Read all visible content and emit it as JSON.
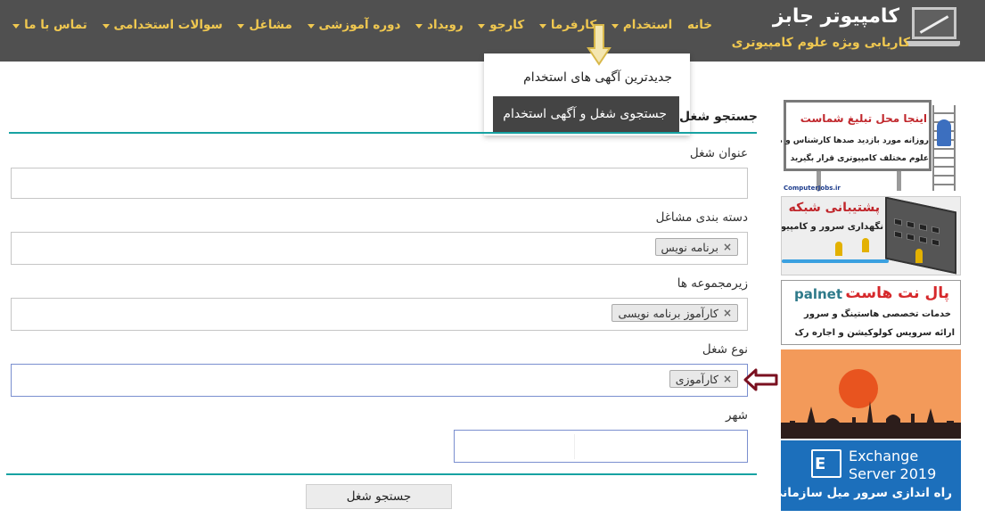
{
  "header": {
    "logo_title": "کامپیوتر جابز",
    "logo_subtitle": "کاریابی ویژه علوم کامپیوتری",
    "nav": [
      {
        "label": "خانه",
        "has_dropdown": false
      },
      {
        "label": "استخدام",
        "has_dropdown": true
      },
      {
        "label": "کارفرما",
        "has_dropdown": true
      },
      {
        "label": "کارجو",
        "has_dropdown": true
      },
      {
        "label": "رویداد",
        "has_dropdown": true
      },
      {
        "label": "دوره آموزشی",
        "has_dropdown": true
      },
      {
        "label": "مشاغل",
        "has_dropdown": true
      },
      {
        "label": "سوالات استخدامی",
        "has_dropdown": true
      },
      {
        "label": "تماس با ما",
        "has_dropdown": true
      }
    ],
    "accent_color": "#f0c850",
    "bar_color": "#505050"
  },
  "dropdown": {
    "items": [
      {
        "label": "جدیدترین آگهی های استخدام"
      },
      {
        "label": "جستجوی شغل و آگهی استخدام"
      }
    ]
  },
  "search_form": {
    "section_title": "جستجو شغل",
    "job_title_label": "عنوان شغل",
    "job_title_value": "",
    "category_label": "دسته بندی مشاغل",
    "category_tokens": [
      "برنامه نویس"
    ],
    "subcategory_label": "زیرمجموعه ها",
    "subcategory_tokens": [
      "کارآموز برنامه نویسی"
    ],
    "job_type_label": "نوع شغل",
    "job_type_tokens": [
      "کارآموزی"
    ],
    "city_label": "شهر",
    "city_value": "",
    "submit_label": "جستجو شغل",
    "remove_symbol": "×"
  },
  "ads": {
    "billboard": {
      "title": "اینجا محل تبلیغ شماست",
      "line1": "روزانه مورد بازدید صدها کارشناس و مدیر",
      "line2": "علوم مختلف کامپیوتری قرار بگیرید",
      "footer": "ComputerJobs.ir"
    },
    "network": {
      "title": "پشتیبانی شبکه",
      "subtitle": "نگهداری سرور و کامپیوتر"
    },
    "hosting": {
      "brand": "پال نت هاست",
      "logo": "palnet",
      "line1": "خدمات تخصصی هاستینگ و سرور",
      "line2": "ارائه سرویس کولوکیشن و اجاره رک"
    },
    "exchange": {
      "title_line1": "Exchange",
      "title_line2": "Server 2019",
      "subtitle": "راه اندازی سرور میل سازمانی"
    }
  }
}
